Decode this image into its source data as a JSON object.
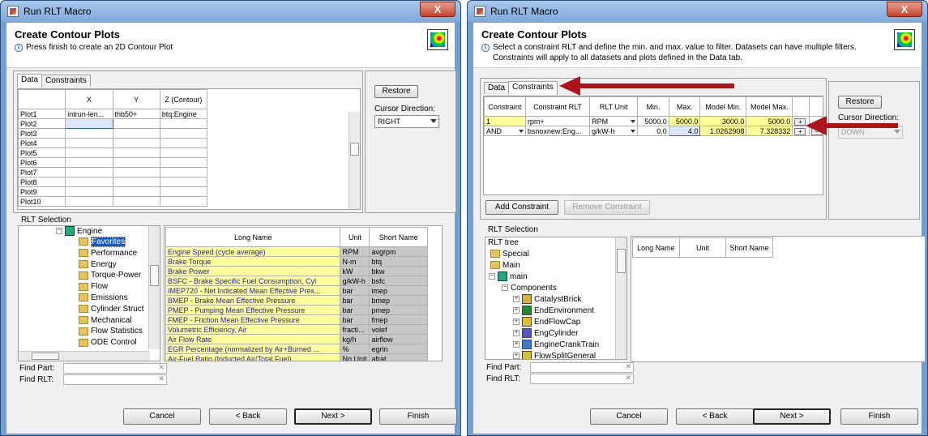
{
  "left": {
    "window_title": "Run RLT Macro",
    "close_label": "X",
    "header_title": "Create Contour Plots",
    "header_subtitle": "Press finish to create an 2D Contour Plot",
    "tabs": [
      "Data",
      "Constraints"
    ],
    "data_columns": [
      "",
      "X",
      "Y",
      "Z (Contour)"
    ],
    "plots": [
      {
        "name": "Plot1",
        "x": "intrun-len...",
        "y": "thb50+",
        "z": "btq:Engine"
      },
      {
        "name": "Plot2",
        "x": "",
        "y": "",
        "z": ""
      },
      {
        "name": "Plot3",
        "x": "",
        "y": "",
        "z": ""
      },
      {
        "name": "Plot4",
        "x": "",
        "y": "",
        "z": ""
      },
      {
        "name": "Plot5",
        "x": "",
        "y": "",
        "z": ""
      },
      {
        "name": "Plot6",
        "x": "",
        "y": "",
        "z": ""
      },
      {
        "name": "Plot7",
        "x": "",
        "y": "",
        "z": ""
      },
      {
        "name": "Plot8",
        "x": "",
        "y": "",
        "z": ""
      },
      {
        "name": "Plot9",
        "x": "",
        "y": "",
        "z": ""
      },
      {
        "name": "Plot10",
        "x": "",
        "y": "",
        "z": ""
      }
    ],
    "restore_label": "Restore",
    "cursor_direction_label": "Cursor Direction:",
    "cursor_direction_value": "RIGHT",
    "rlt_selection_label": "RLT Selection",
    "tree": {
      "root": "Engine",
      "items": [
        "Favorites",
        "Performance",
        "Energy",
        "Torque-Power",
        "Flow",
        "Emissions",
        "Cylinder Struct",
        "Mechanical",
        "Flow Statistics",
        "ODE Control"
      ]
    },
    "rlt_columns": [
      "Long Name",
      "Unit",
      "Short Name"
    ],
    "rlt_rows": [
      {
        "long": "Engine Speed (cycle average)",
        "unit": "RPM",
        "short": "avgrpm"
      },
      {
        "long": "Brake Torque",
        "unit": "N-m",
        "short": "btq"
      },
      {
        "long": "Brake Power",
        "unit": "kW",
        "short": "bkw"
      },
      {
        "long": "BSFC - Brake Specific Fuel Consumption, Cyl",
        "unit": "g/kW-h",
        "short": "bsfc"
      },
      {
        "long": "IMEP720 - Net Indicated Mean Effective Pres...",
        "unit": "bar",
        "short": "imep"
      },
      {
        "long": "BMEP - Brake Mean Effective Pressure",
        "unit": "bar",
        "short": "bmep"
      },
      {
        "long": "PMEP - Pumping Mean Effective Pressure",
        "unit": "bar",
        "short": "pmep"
      },
      {
        "long": "FMEP - Friction Mean Effective Pressure",
        "unit": "bar",
        "short": "fmep"
      },
      {
        "long": "Volumetric Efficiency, Air",
        "unit": "fracti...",
        "short": "volef"
      },
      {
        "long": "Air Flow Rate",
        "unit": "kg/h",
        "short": "airflow"
      },
      {
        "long": "EGR Percentage (normalized by Air+Burned ...",
        "unit": "%",
        "short": "egrin"
      },
      {
        "long": "Air-Fuel Ratio (Inducted Air/Total Fuel)",
        "unit": "No Unit",
        "short": "afrat"
      }
    ],
    "find_part_label": "Find Part:",
    "find_rlt_label": "Find RLT:",
    "buttons": {
      "cancel": "Cancel",
      "back": "< Back",
      "next": "Next >",
      "finish": "Finish"
    }
  },
  "right": {
    "window_title": "Run RLT Macro",
    "close_label": "X",
    "header_title": "Create Contour Plots",
    "header_subtitle_1": "Select a constraint RLT and define the min. and max. value to filter. Datasets can have multiple filters.",
    "header_subtitle_2": "Constraints will apply to all datasets and plots defined in the Data tab.",
    "tabs": [
      "Data",
      "Constraints"
    ],
    "constraint_columns": [
      "Constraint",
      "Constraint RLT",
      "RLT Unit",
      "Min.",
      "Max.",
      "Model Min.",
      "Model Max."
    ],
    "constraints": [
      {
        "constraint": "1",
        "rlt": "rpm+",
        "unit": "RPM",
        "min": "5000.0",
        "max": "5000.0",
        "model_min": "3000.0",
        "model_max": "5000.0"
      },
      {
        "constraint": "AND",
        "rlt": "bsnoxnew:Eng...",
        "unit": "g/kW-h",
        "min": "0.0",
        "max": "4.0",
        "model_min": "1.0262908",
        "model_max": "7.328332"
      }
    ],
    "add_constraint_label": "Add Constraint",
    "remove_constraint_label": "Remove Constraint",
    "restore_label": "Restore",
    "cursor_direction_label": "Cursor Direction:",
    "cursor_direction_value": "DOWN",
    "rlt_selection_label": "RLT Selection",
    "tree": {
      "root": "RLT tree",
      "top_items": [
        "Special",
        "Main",
        "main"
      ],
      "components_label": "Components",
      "components": [
        "CatalystBrick",
        "EndEnvironment",
        "EndFlowCap",
        "EngCylinder",
        "EngineCrankTrain",
        "FlowSplitGeneral"
      ]
    },
    "rlt_columns": [
      "Long Name",
      "Unit",
      "Short Name"
    ],
    "find_part_label": "Find Part:",
    "find_rlt_label": "Find RLT:",
    "buttons": {
      "cancel": "Cancel",
      "back": "< Back",
      "next": "Next >",
      "finish": "Finish"
    }
  },
  "colors": {
    "arrow": "#b01418",
    "highlight": "#ffff99",
    "selection": "#0a5bd6"
  }
}
